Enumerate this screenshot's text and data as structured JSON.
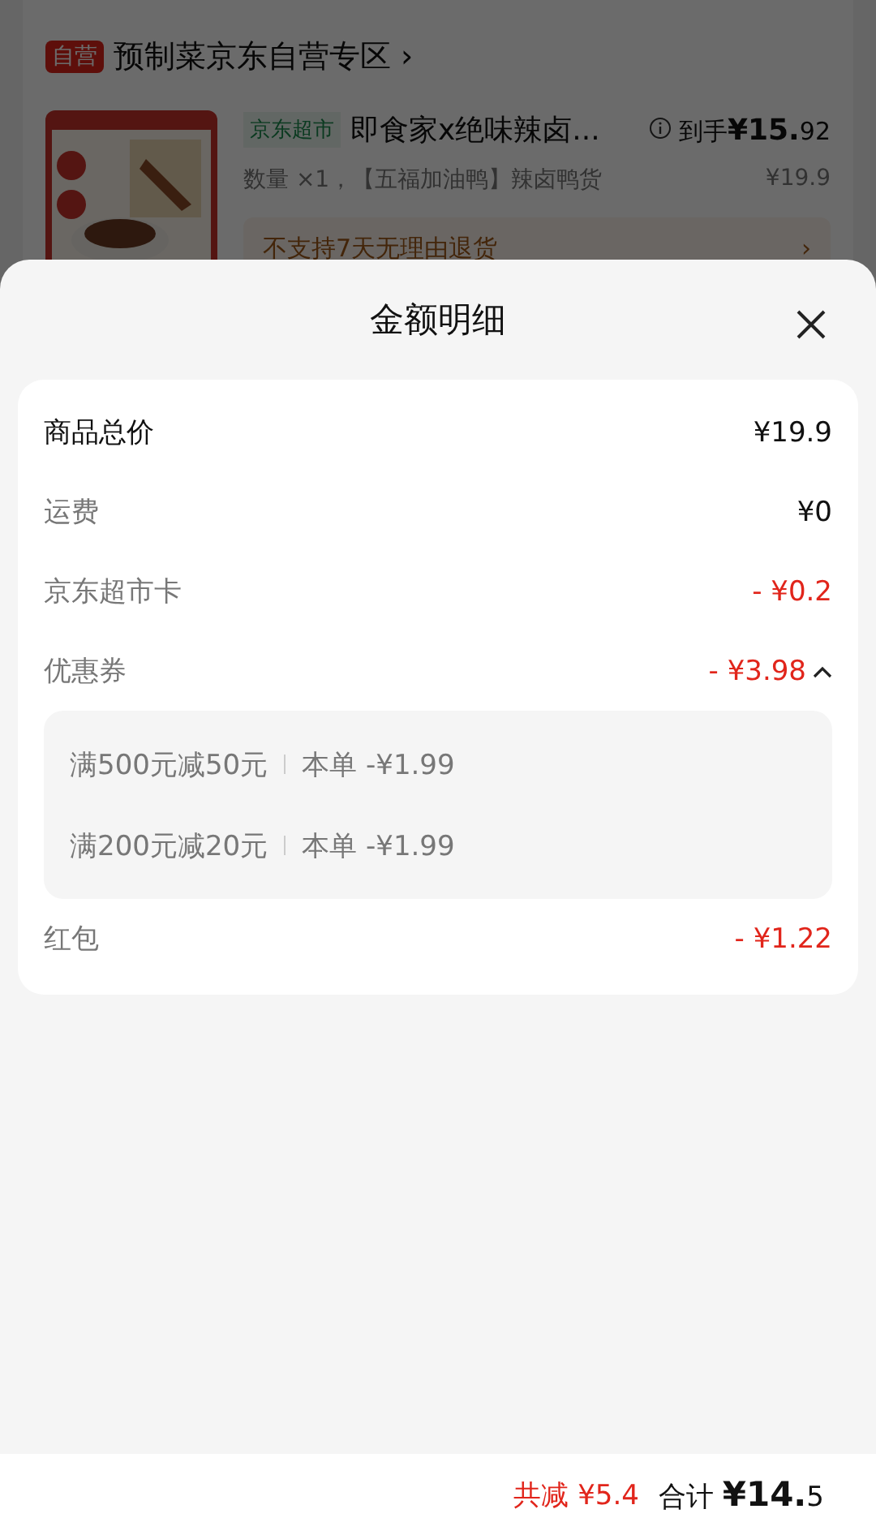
{
  "background_page": {
    "store_badge": "自营",
    "store_title": "预制菜京东自营专区",
    "store_chevron": "›",
    "product": {
      "kind": "picture",
      "channel_tag": "京东超市",
      "name": "即食家x绝味辣卤...",
      "final_label": "到手",
      "final_price_int": "¥15.",
      "final_price_dec": "92",
      "spec": "数量 ×1，【五福加油鸭】辣卤鸭货",
      "price": "¥19.9",
      "notice": "不支持7天无理由退货",
      "notice_chevron": "›"
    }
  },
  "sheet": {
    "title": "金额明细",
    "rows": [
      {
        "label": "商品总价",
        "value": "¥19.9",
        "kind": "total"
      },
      {
        "label": "运费",
        "value": "¥0",
        "kind": "amount"
      },
      {
        "label": "京东超市卡",
        "value": "- ¥0.2",
        "kind": "discount"
      },
      {
        "label": "优惠券",
        "value": "- ¥3.98",
        "kind": "discount",
        "expanded": true,
        "children": [
          {
            "condition": "满500元减50元",
            "detail": "本单 -¥1.99"
          },
          {
            "condition": "满200元减20元",
            "detail": "本单 -¥1.99"
          }
        ]
      },
      {
        "label": "红包",
        "value": "- ¥1.22",
        "kind": "discount"
      }
    ]
  },
  "footer": {
    "saved_label": "共减",
    "saved_value": "¥5.4",
    "total_label": "合计",
    "total_int": "¥14.",
    "total_dec": "5"
  }
}
